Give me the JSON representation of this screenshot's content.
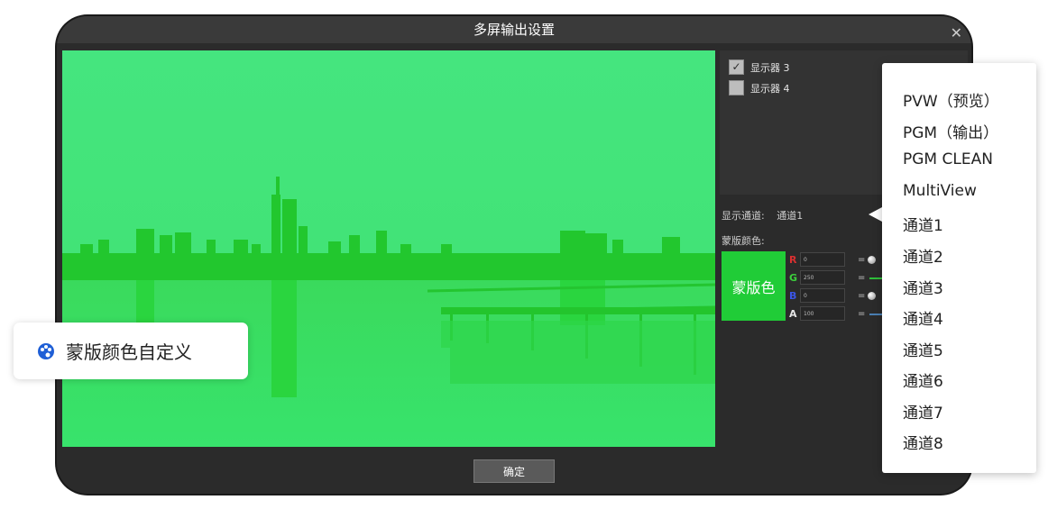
{
  "window": {
    "title": "多屏输出设置",
    "close_glyph": "✕"
  },
  "displays": [
    {
      "label": "显示器 3",
      "checked": true
    },
    {
      "label": "显示器 4",
      "checked": false
    }
  ],
  "channel": {
    "label": "显示通道:",
    "value": "通道1"
  },
  "mask": {
    "label": "蒙版颜色:",
    "swatch_label": "蒙版色",
    "color": "#20cc37",
    "fields": [
      {
        "letter": "R",
        "value": "0",
        "color": "#d93030"
      },
      {
        "letter": "G",
        "value": "250",
        "color": "#3ccf3c"
      },
      {
        "letter": "B",
        "value": "0",
        "color": "#3b56e6"
      },
      {
        "letter": "A",
        "value": "100",
        "color": "#e6e6e6"
      }
    ]
  },
  "footer": {
    "ok_label": "确定"
  },
  "dropdown": {
    "items": [
      "PVW（预览）",
      "PGM（输出）",
      "PGM CLEAN",
      "MultiView",
      "通道1",
      "通道2",
      "通道3",
      "通道4",
      "通道5",
      "通道6",
      "通道7",
      "通道8"
    ]
  },
  "callout": {
    "text": "蒙版颜色自定义",
    "icon": "palette-icon"
  }
}
